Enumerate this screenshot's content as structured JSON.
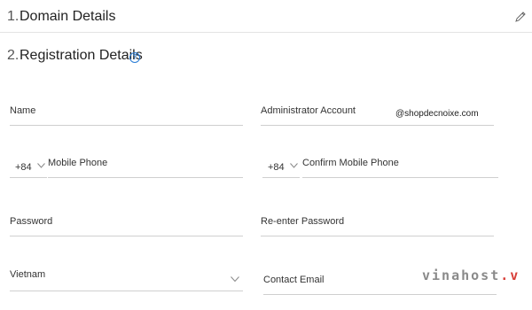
{
  "sections": {
    "domain_details": {
      "number": "1.",
      "title": "Domain Details",
      "edit_icon": "pencil-icon"
    },
    "registration_details": {
      "number": "2.",
      "title": "Registration Details",
      "help_icon": "question-circle-icon",
      "help_glyph": "?"
    }
  },
  "form": {
    "name": {
      "label": "Name"
    },
    "administrator_account": {
      "label": "Administrator Account",
      "domain_suffix": "@shopdecnoixe.com"
    },
    "mobile_phone": {
      "country_code": "+84",
      "label": "Mobile Phone"
    },
    "confirm_mobile_phone": {
      "country_code": "+84",
      "label": "Confirm Mobile Phone"
    },
    "password": {
      "label": "Password"
    },
    "reenter_password": {
      "label": "Re-enter Password"
    },
    "country": {
      "value": "Vietnam"
    },
    "contact_email": {
      "label": "Contact Email"
    }
  },
  "watermark": {
    "text_a": "vinahost",
    "text_b": ".",
    "text_c": "v"
  },
  "colors": {
    "accent": "#2a7dd6",
    "divider": "#e3e3e3",
    "underline": "#cfcfcf",
    "watermark_red": "#d8403a"
  }
}
